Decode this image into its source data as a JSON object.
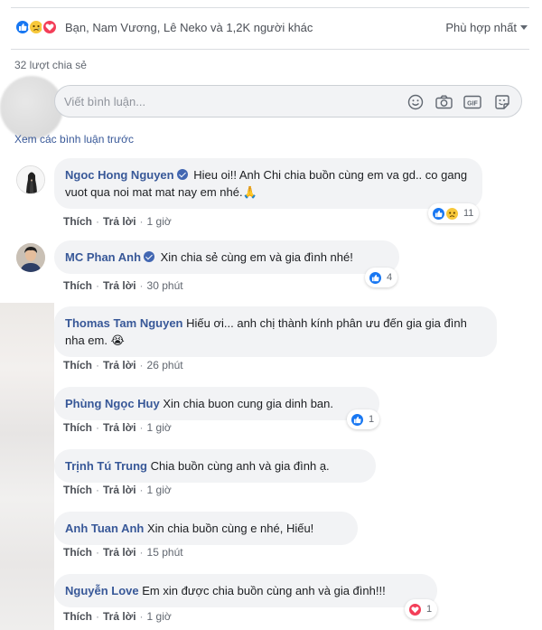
{
  "reactions": {
    "names": "Bạn, Nam Vương, Lê Neko và 1,2K người khác",
    "sort_label": "Phù hợp nhất",
    "icons": [
      "like-icon",
      "sad-icon",
      "love-icon"
    ]
  },
  "shares": "32 lượt chia sẻ",
  "composer": {
    "placeholder": "Viết bình luận...",
    "icons": [
      "emoji-icon",
      "camera-icon",
      "gif-icon",
      "sticker-icon"
    ]
  },
  "prev_comments": "Xem các bình luận trước",
  "labels": {
    "like": "Thích",
    "reply": "Trả lời"
  },
  "comments": [
    {
      "author": "Ngoc Hong Nguyen",
      "verified": true,
      "text": "Hieu oi!! Anh Chi chia buồn cùng em va gd.. co gang vuot qua noi mat mat nay em nhé.🙏",
      "time": "1 giờ",
      "reaction_count": "11"
    },
    {
      "author": "MC Phan Anh",
      "verified": true,
      "text": "Xin chia sẻ cùng em và gia đình nhé!",
      "time": "30 phút",
      "reaction_count": "4"
    },
    {
      "author": "Thomas Tam Nguyen",
      "verified": false,
      "text": "Hiếu ơi... anh chị thành kính phân ưu đến gia gia đình nha em. 😭",
      "time": "26 phút",
      "reaction_count": ""
    },
    {
      "author": "Phùng Ngọc Huy",
      "verified": false,
      "text": "Xin chia buon cung gia dinh ban.",
      "time": "1 giờ",
      "reaction_count": "1"
    },
    {
      "author": "Trịnh Tú Trung",
      "verified": false,
      "text": "Chia buồn cùng anh và gia đình ạ.",
      "time": "1 giờ",
      "reaction_count": ""
    },
    {
      "author": "Anh Tuan Anh",
      "verified": false,
      "text": "Xin chia buồn cùng e nhé, Hiếu!",
      "time": "15 phút",
      "reaction_count": ""
    },
    {
      "author": "Nguyễn Love",
      "verified": false,
      "text": "Em xin được chia buồn cùng anh và gia đình!!!",
      "time": "1 giờ",
      "reaction_count": "1"
    }
  ],
  "colors": {
    "link": "#385898",
    "like": "#1877f2",
    "love": "#f33e58",
    "sad": "#f7c83a",
    "bubble": "#f2f3f5"
  }
}
